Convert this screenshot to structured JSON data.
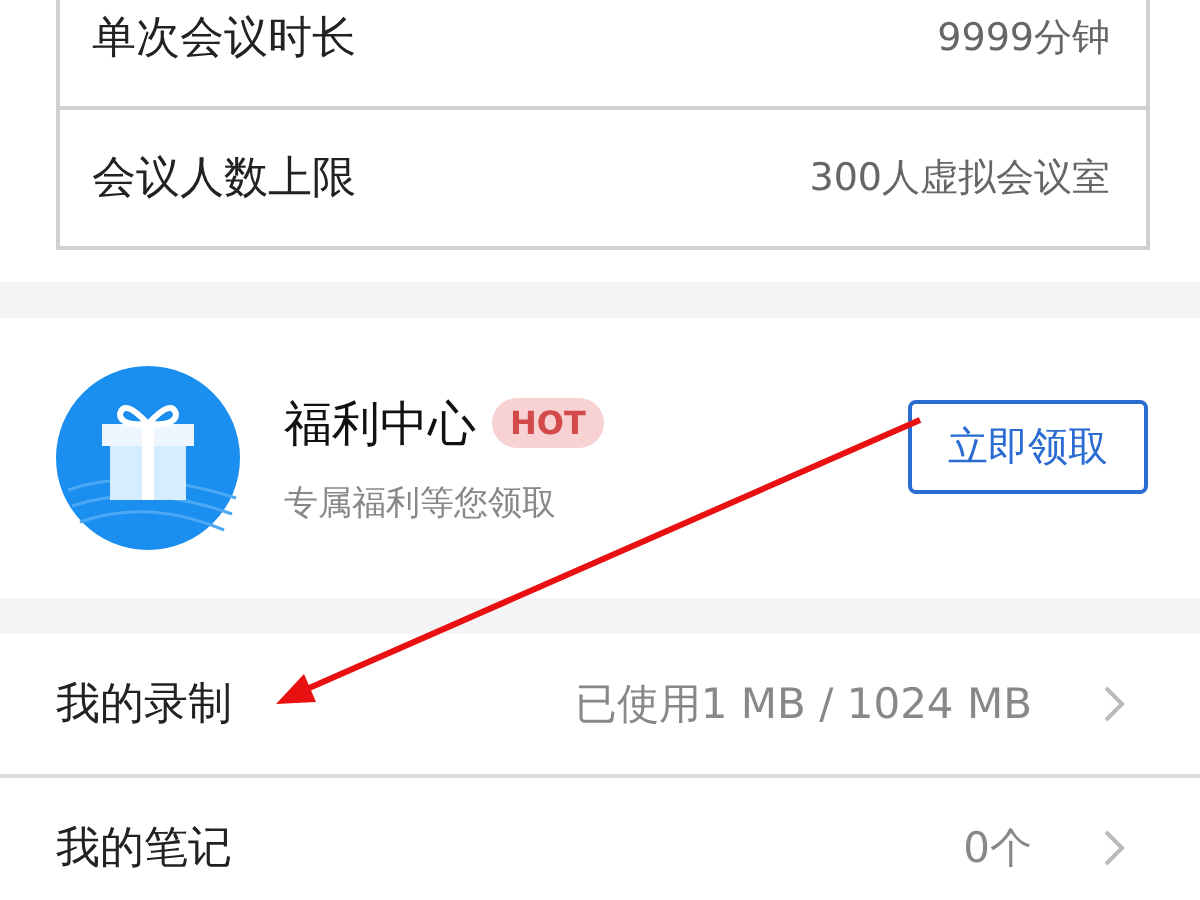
{
  "spec_table": {
    "rows": [
      {
        "label": "单次会议时长",
        "value": "9999分钟"
      },
      {
        "label": "会议人数上限",
        "value": "300人虚拟会议室"
      }
    ]
  },
  "welfare": {
    "title": "福利中心",
    "badge": "HOT",
    "subtitle": "专属福利等您领取",
    "button": "立即领取"
  },
  "menu": [
    {
      "label": "我的录制",
      "value": "已使用1 MB / 1024 MB"
    },
    {
      "label": "我的笔记",
      "value": "0个"
    }
  ]
}
